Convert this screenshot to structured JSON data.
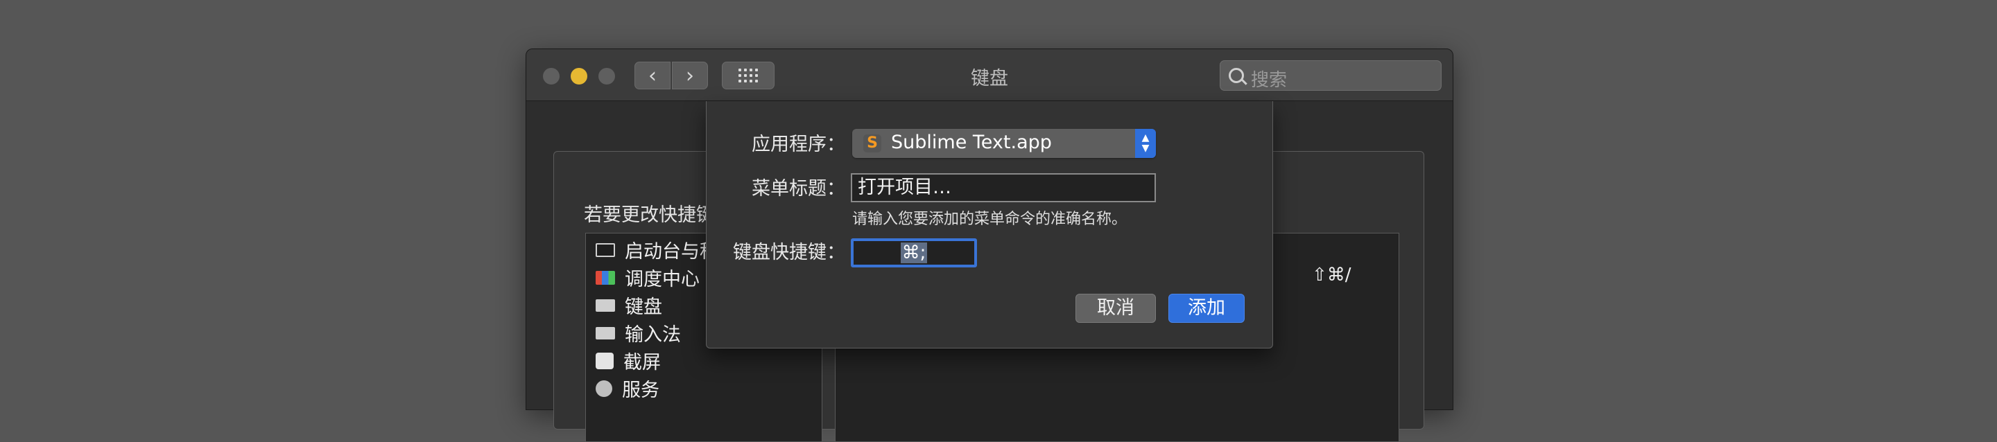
{
  "window": {
    "title": "键盘",
    "search_placeholder": "搜索",
    "back_label": "‹",
    "forward_label": "›"
  },
  "pane": {
    "hint": "若要更改快捷键",
    "categories": [
      {
        "label": "启动台与程序坞",
        "icon": "launchpad-icon"
      },
      {
        "label": "调度中心",
        "icon": "mission-control-icon"
      },
      {
        "label": "键盘",
        "icon": "keyboard-icon"
      },
      {
        "label": "输入法",
        "icon": "keyboard-icon"
      },
      {
        "label": "截屏",
        "icon": "screenshot-icon"
      },
      {
        "label": "服务",
        "icon": "gear-icon"
      }
    ],
    "right_shortcut": "⇧⌘/"
  },
  "sheet": {
    "app_label": "应用程序：",
    "app_value": "Sublime Text.app",
    "menu_title_label": "菜单标题：",
    "menu_title_value": "打开项目…",
    "helper_text": "请输入您要添加的菜单命令的准确名称。",
    "shortcut_label": "键盘快捷键：",
    "shortcut_value": "⌘;",
    "cancel_label": "取消",
    "add_label": "添加"
  },
  "colors": {
    "accent": "#2f6fdb",
    "background": "#565656",
    "window": "#2d2d2d",
    "minimize_light": "#e6b832"
  }
}
